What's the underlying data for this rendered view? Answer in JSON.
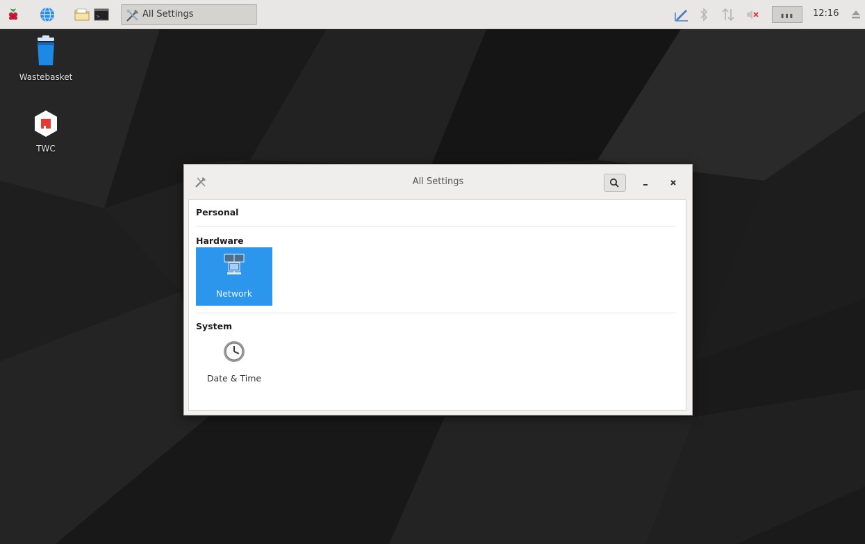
{
  "taskbar": {
    "task_button_label": "All Settings",
    "clock": "12:16"
  },
  "desktop": {
    "icons": [
      {
        "label": "Wastebasket"
      },
      {
        "label": "TWC"
      }
    ]
  },
  "window": {
    "title": "All Settings",
    "sections": [
      {
        "title": "Personal",
        "items": []
      },
      {
        "title": "Hardware",
        "items": [
          {
            "label": "Network",
            "icon": "network-icon",
            "selected": true
          }
        ]
      },
      {
        "title": "System",
        "items": [
          {
            "label": "Date & Time",
            "icon": "clock-icon",
            "selected": false
          }
        ]
      }
    ]
  },
  "colors": {
    "selection": "#2c96ec",
    "taskbar": "#e9e7e5",
    "desktop": "#1b1b1b"
  }
}
